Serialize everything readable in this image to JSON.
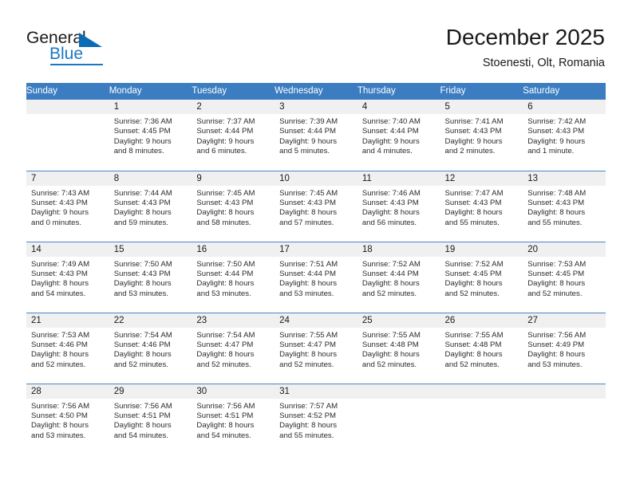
{
  "brand": {
    "word_one": "General",
    "word_two": "Blue",
    "accent_color": "#1878c4",
    "triangle_color": "#0b6bb5"
  },
  "header": {
    "title": "December 2025",
    "subtitle": "Stoenesti, Olt, Romania"
  },
  "calendar": {
    "header_bg": "#3b7dc0",
    "daynum_bg": "#f0f0f0",
    "weekday_headers": [
      "Sunday",
      "Monday",
      "Tuesday",
      "Wednesday",
      "Thursday",
      "Friday",
      "Saturday"
    ],
    "weeks": [
      [
        {
          "day": "",
          "sunrise": "",
          "sunset": "",
          "daylight_line1": "",
          "daylight_line2": ""
        },
        {
          "day": "1",
          "sunrise": "Sunrise: 7:36 AM",
          "sunset": "Sunset: 4:45 PM",
          "daylight_line1": "Daylight: 9 hours",
          "daylight_line2": "and 8 minutes."
        },
        {
          "day": "2",
          "sunrise": "Sunrise: 7:37 AM",
          "sunset": "Sunset: 4:44 PM",
          "daylight_line1": "Daylight: 9 hours",
          "daylight_line2": "and 6 minutes."
        },
        {
          "day": "3",
          "sunrise": "Sunrise: 7:39 AM",
          "sunset": "Sunset: 4:44 PM",
          "daylight_line1": "Daylight: 9 hours",
          "daylight_line2": "and 5 minutes."
        },
        {
          "day": "4",
          "sunrise": "Sunrise: 7:40 AM",
          "sunset": "Sunset: 4:44 PM",
          "daylight_line1": "Daylight: 9 hours",
          "daylight_line2": "and 4 minutes."
        },
        {
          "day": "5",
          "sunrise": "Sunrise: 7:41 AM",
          "sunset": "Sunset: 4:43 PM",
          "daylight_line1": "Daylight: 9 hours",
          "daylight_line2": "and 2 minutes."
        },
        {
          "day": "6",
          "sunrise": "Sunrise: 7:42 AM",
          "sunset": "Sunset: 4:43 PM",
          "daylight_line1": "Daylight: 9 hours",
          "daylight_line2": "and 1 minute."
        }
      ],
      [
        {
          "day": "7",
          "sunrise": "Sunrise: 7:43 AM",
          "sunset": "Sunset: 4:43 PM",
          "daylight_line1": "Daylight: 9 hours",
          "daylight_line2": "and 0 minutes."
        },
        {
          "day": "8",
          "sunrise": "Sunrise: 7:44 AM",
          "sunset": "Sunset: 4:43 PM",
          "daylight_line1": "Daylight: 8 hours",
          "daylight_line2": "and 59 minutes."
        },
        {
          "day": "9",
          "sunrise": "Sunrise: 7:45 AM",
          "sunset": "Sunset: 4:43 PM",
          "daylight_line1": "Daylight: 8 hours",
          "daylight_line2": "and 58 minutes."
        },
        {
          "day": "10",
          "sunrise": "Sunrise: 7:45 AM",
          "sunset": "Sunset: 4:43 PM",
          "daylight_line1": "Daylight: 8 hours",
          "daylight_line2": "and 57 minutes."
        },
        {
          "day": "11",
          "sunrise": "Sunrise: 7:46 AM",
          "sunset": "Sunset: 4:43 PM",
          "daylight_line1": "Daylight: 8 hours",
          "daylight_line2": "and 56 minutes."
        },
        {
          "day": "12",
          "sunrise": "Sunrise: 7:47 AM",
          "sunset": "Sunset: 4:43 PM",
          "daylight_line1": "Daylight: 8 hours",
          "daylight_line2": "and 55 minutes."
        },
        {
          "day": "13",
          "sunrise": "Sunrise: 7:48 AM",
          "sunset": "Sunset: 4:43 PM",
          "daylight_line1": "Daylight: 8 hours",
          "daylight_line2": "and 55 minutes."
        }
      ],
      [
        {
          "day": "14",
          "sunrise": "Sunrise: 7:49 AM",
          "sunset": "Sunset: 4:43 PM",
          "daylight_line1": "Daylight: 8 hours",
          "daylight_line2": "and 54 minutes."
        },
        {
          "day": "15",
          "sunrise": "Sunrise: 7:50 AM",
          "sunset": "Sunset: 4:43 PM",
          "daylight_line1": "Daylight: 8 hours",
          "daylight_line2": "and 53 minutes."
        },
        {
          "day": "16",
          "sunrise": "Sunrise: 7:50 AM",
          "sunset": "Sunset: 4:44 PM",
          "daylight_line1": "Daylight: 8 hours",
          "daylight_line2": "and 53 minutes."
        },
        {
          "day": "17",
          "sunrise": "Sunrise: 7:51 AM",
          "sunset": "Sunset: 4:44 PM",
          "daylight_line1": "Daylight: 8 hours",
          "daylight_line2": "and 53 minutes."
        },
        {
          "day": "18",
          "sunrise": "Sunrise: 7:52 AM",
          "sunset": "Sunset: 4:44 PM",
          "daylight_line1": "Daylight: 8 hours",
          "daylight_line2": "and 52 minutes."
        },
        {
          "day": "19",
          "sunrise": "Sunrise: 7:52 AM",
          "sunset": "Sunset: 4:45 PM",
          "daylight_line1": "Daylight: 8 hours",
          "daylight_line2": "and 52 minutes."
        },
        {
          "day": "20",
          "sunrise": "Sunrise: 7:53 AM",
          "sunset": "Sunset: 4:45 PM",
          "daylight_line1": "Daylight: 8 hours",
          "daylight_line2": "and 52 minutes."
        }
      ],
      [
        {
          "day": "21",
          "sunrise": "Sunrise: 7:53 AM",
          "sunset": "Sunset: 4:46 PM",
          "daylight_line1": "Daylight: 8 hours",
          "daylight_line2": "and 52 minutes."
        },
        {
          "day": "22",
          "sunrise": "Sunrise: 7:54 AM",
          "sunset": "Sunset: 4:46 PM",
          "daylight_line1": "Daylight: 8 hours",
          "daylight_line2": "and 52 minutes."
        },
        {
          "day": "23",
          "sunrise": "Sunrise: 7:54 AM",
          "sunset": "Sunset: 4:47 PM",
          "daylight_line1": "Daylight: 8 hours",
          "daylight_line2": "and 52 minutes."
        },
        {
          "day": "24",
          "sunrise": "Sunrise: 7:55 AM",
          "sunset": "Sunset: 4:47 PM",
          "daylight_line1": "Daylight: 8 hours",
          "daylight_line2": "and 52 minutes."
        },
        {
          "day": "25",
          "sunrise": "Sunrise: 7:55 AM",
          "sunset": "Sunset: 4:48 PM",
          "daylight_line1": "Daylight: 8 hours",
          "daylight_line2": "and 52 minutes."
        },
        {
          "day": "26",
          "sunrise": "Sunrise: 7:55 AM",
          "sunset": "Sunset: 4:48 PM",
          "daylight_line1": "Daylight: 8 hours",
          "daylight_line2": "and 52 minutes."
        },
        {
          "day": "27",
          "sunrise": "Sunrise: 7:56 AM",
          "sunset": "Sunset: 4:49 PM",
          "daylight_line1": "Daylight: 8 hours",
          "daylight_line2": "and 53 minutes."
        }
      ],
      [
        {
          "day": "28",
          "sunrise": "Sunrise: 7:56 AM",
          "sunset": "Sunset: 4:50 PM",
          "daylight_line1": "Daylight: 8 hours",
          "daylight_line2": "and 53 minutes."
        },
        {
          "day": "29",
          "sunrise": "Sunrise: 7:56 AM",
          "sunset": "Sunset: 4:51 PM",
          "daylight_line1": "Daylight: 8 hours",
          "daylight_line2": "and 54 minutes."
        },
        {
          "day": "30",
          "sunrise": "Sunrise: 7:56 AM",
          "sunset": "Sunset: 4:51 PM",
          "daylight_line1": "Daylight: 8 hours",
          "daylight_line2": "and 54 minutes."
        },
        {
          "day": "31",
          "sunrise": "Sunrise: 7:57 AM",
          "sunset": "Sunset: 4:52 PM",
          "daylight_line1": "Daylight: 8 hours",
          "daylight_line2": "and 55 minutes."
        },
        {
          "day": "",
          "sunrise": "",
          "sunset": "",
          "daylight_line1": "",
          "daylight_line2": ""
        },
        {
          "day": "",
          "sunrise": "",
          "sunset": "",
          "daylight_line1": "",
          "daylight_line2": ""
        },
        {
          "day": "",
          "sunrise": "",
          "sunset": "",
          "daylight_line1": "",
          "daylight_line2": ""
        }
      ]
    ]
  }
}
